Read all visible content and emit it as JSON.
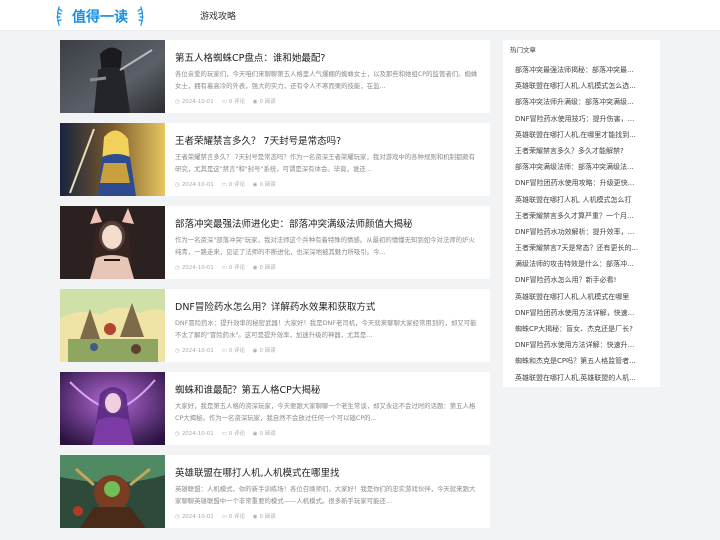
{
  "header": {
    "logo_text": "值得一读",
    "nav": [
      "游戏攻略"
    ]
  },
  "articles": [
    {
      "title": "第五人格蜘蛛CP盘点：谁和她最配?",
      "excerpt": "各位亲爱的玩家们，今天咱们来聊聊第五人格里人气爆棚的蜘蛛女士，以及那些和她组CP的监管者们。蜘蛛女士，拥有着高冷的外表，强大的实力，还有令人不寒而栗的技能，在监...",
      "date": "2024-10-01",
      "comments": "0 评论",
      "views": "0 阅读"
    },
    {
      "title": "王者荣耀禁言多久？ 7天封号是常态吗?",
      "excerpt": "王者荣耀禁言多久？ 7天封号是常态吗？作为一名资深王者荣耀玩家，我对游戏中的各种规则和机制都颇有研究，尤其是这\"禁言\"和\"封号\"系统，可谓是深有体会。毕竟，谁还...",
      "date": "2024-10-01",
      "comments": "0 评论",
      "views": "0 阅读"
    },
    {
      "title": "部落冲突最强法师进化史：部落冲突满级法师颜值大揭秘",
      "excerpt": "作为一名资深\"部落冲突\"玩家，我对法师这个兵种有着特殊的情感。从最初的懵懂无知到如今对法师的炉火纯青，一路走来，见证了法师的不断进化，也深深地被其魅力所吸引。今...",
      "date": "2024-10-01",
      "comments": "0 评论",
      "views": "0 阅读"
    },
    {
      "title": "DNF冒险药水怎么用？详解药水效果和获取方式",
      "excerpt": "DNF冒险药水：提升效率的秘密武器！大家好！我是DNF老司机，今天就来聊聊大家经常用到的，却又可能不太了解的\"冒险药水\"。这可是提升效率，加速升级的神器，尤其是...",
      "date": "2024-10-01",
      "comments": "0 评论",
      "views": "0 阅读"
    },
    {
      "title": "蜘蛛和谁最配？第五人格CP大揭秘",
      "excerpt": "大家好，我是第五人格的资深玩家，今天要跟大家聊聊一个老生常谈，却又永远不会过时的话题：第五人格CP大揭秘。作为一名资深玩家，我自然不会放过任何一个可以磕CP的...",
      "date": "2024-10-01",
      "comments": "0 评论",
      "views": "0 阅读"
    },
    {
      "title": "英雄联盟在哪打人机,人机模式在哪里找",
      "excerpt": "英雄联盟：人机模式，你的新手训练场！各位召唤师们，大家好！我是你们的忠实游戏伙伴，今天就来跟大家聊聊英雄联盟中一个非常重要的模式——人机模式。很多新手玩家可能还...",
      "date": "2024-10-01",
      "comments": "0 评论",
      "views": "0 阅读"
    }
  ],
  "sidebar": {
    "title": "热门文章",
    "items": [
      "部落冲突最强法师揭秘：部落冲突最...",
      "英雄联盟在哪打人机,人机模式怎么选...",
      "部落冲突法师升满级：部落冲突满级...",
      "DNF冒险药水使用技巧：提升伤害，...",
      "英雄联盟在哪打人机,在哪里才能找到...",
      "王者荣耀禁言多久？多久才能解禁?",
      "部落冲突满级法师：部落冲突满级法...",
      "DNF冒险团药水使用攻略：升级更快...",
      "英雄联盟在哪打人机, 人机模式怎么打",
      "王者荣耀禁言多久才算严重？一个月...",
      "DNF冒险药水功效解析：提升效率，...",
      "王者荣耀禁言7天是常态？还有更长的...",
      "满级法师的攻击特效是什么：部落冲...",
      "DNF冒险药水怎么用？新手必看!",
      "英雄联盟在哪打人机,人机模式在哪里",
      "DNF冒险团药水使用方法详解，快速...",
      "蜘蛛CP大揭秘：盲女、杰克还是厂长?",
      "DNF冒险药水使用方法详解：快速升...",
      "蜘蛛和杰克是CP吗？第五人格监管者...",
      "英雄联盟在哪打人机,英雄联盟的人机..."
    ]
  },
  "icons": {
    "date": "clock-icon",
    "comments": "chat-icon",
    "views": "eye-icon"
  },
  "colors": {
    "logo_blue": "#1a8fe3",
    "background": "#f2f3f5",
    "card": "#ffffff"
  }
}
